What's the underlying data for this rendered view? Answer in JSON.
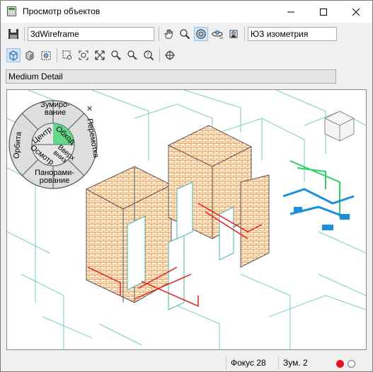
{
  "window": {
    "title": "Просмотр объектов",
    "minimize_icon": "minimize-icon",
    "maximize_icon": "maximize-icon",
    "close_icon": "close-icon"
  },
  "toolbar": {
    "visual_style": "3dWireframe",
    "view": "ЮЗ изометрия",
    "detail_level": "Medium Detail",
    "icons": [
      "save-icon",
      "pan-icon",
      "zoom-icon",
      "orbit-icon",
      "fly-icon",
      "camera-icon",
      "wireframe-icon",
      "shaded-icon",
      "capture-icon",
      "zoom-window-icon",
      "zoom-dynamic-icon",
      "zoom-extents-icon",
      "zoom-in-icon",
      "zoom-out-icon",
      "zoom-previous-icon",
      "locate-icon"
    ]
  },
  "wheel": {
    "zoom": "Зумиро-\nвание",
    "center": "Центр",
    "walk": "Обход",
    "rewind": "Перемотка",
    "orbit": "Орбита",
    "up_down_top": "Вверх",
    "up_down_bottom": "вниз",
    "look": "Осмотр",
    "pan": "Панорами-\nрование"
  },
  "status": {
    "focus": "Фокус 28",
    "zoom": "Зум. 2"
  },
  "colors": {
    "brick": "#e8862a",
    "wire": "#2aa7a4",
    "accent_green": "#2ecf63",
    "pipe_blue": "#1a90d8",
    "red_line": "#e02020",
    "status_red": "#e81123"
  }
}
